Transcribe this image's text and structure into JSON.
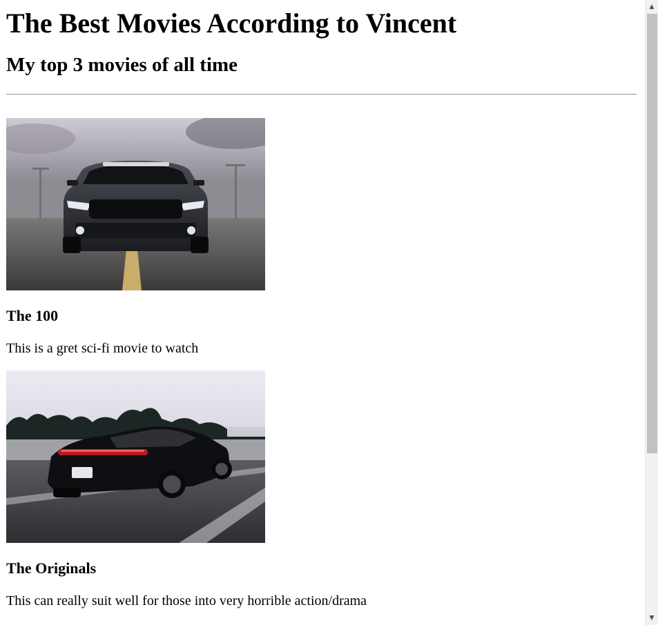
{
  "page": {
    "title": "The Best Movies According to Vincent",
    "subtitle": "My top 3 movies of all time"
  },
  "movies": [
    {
      "title": "The 100",
      "description": "This is a gret sci-fi movie to watch",
      "image": "black-mustang-car-photo"
    },
    {
      "title": "The Originals",
      "description": "This can really suit well for those into very horrible action/drama",
      "image": "black-porsche-car-photo"
    }
  ],
  "scrollbar": {
    "up_icon": "triangle-up-icon",
    "down_icon": "triangle-down-icon",
    "position_fraction": 0.0,
    "visible_fraction": 0.72
  }
}
